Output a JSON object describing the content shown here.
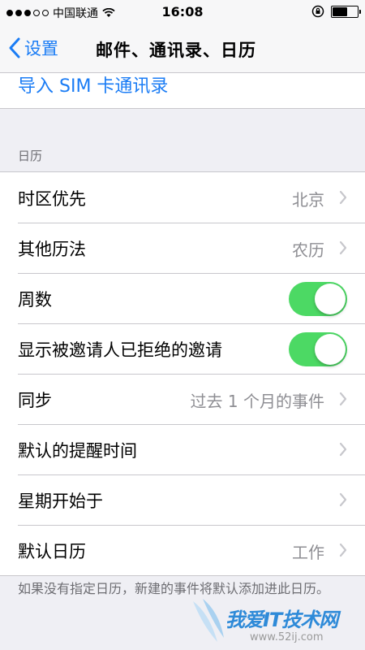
{
  "status_bar": {
    "carrier": "中国联通",
    "time": "16:08",
    "signal_bars": 3
  },
  "nav": {
    "back_label": "设置",
    "title": "邮件、通讯录、日历"
  },
  "import_link": "导入 SIM 卡通讯录",
  "calendar_section": {
    "header": "日历",
    "rows": [
      {
        "label": "时区优先",
        "value": "北京"
      },
      {
        "label": "其他历法",
        "value": "农历"
      },
      {
        "label": "周数",
        "toggle": true
      },
      {
        "label": "显示被邀请人已拒绝的邀请",
        "toggle": true
      },
      {
        "label": "同步",
        "value": "过去 1 个月的事件"
      },
      {
        "label": "默认的提醒时间",
        "value": ""
      },
      {
        "label": "星期开始于",
        "value": ""
      },
      {
        "label": "默认日历",
        "value": "工作"
      }
    ],
    "footer": "如果没有指定日历，新建的事件将默认添加进此日历。"
  },
  "watermark": {
    "text": "我爱IT技术网",
    "url": "www.52ij.com"
  },
  "colors": {
    "accent": "#1a7cf5",
    "toggle_on": "#4cd964"
  }
}
